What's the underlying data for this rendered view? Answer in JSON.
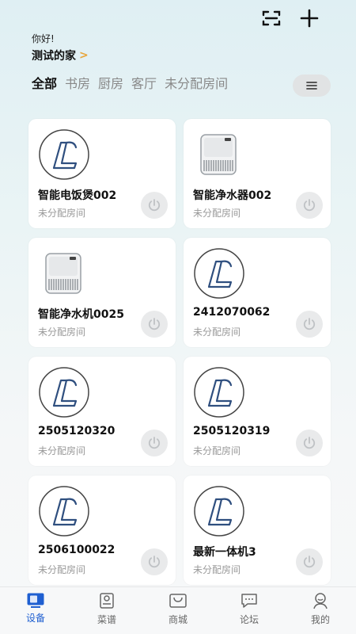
{
  "header": {
    "scan_icon": "scan-icon",
    "add_icon": "plus-icon",
    "greeting": "你好!",
    "home_name": "测试的家",
    "home_arrow": ">"
  },
  "tabs": [
    {
      "label": "全部",
      "active": true
    },
    {
      "label": "书房",
      "active": false
    },
    {
      "label": "厨房",
      "active": false
    },
    {
      "label": "客厅",
      "active": false
    },
    {
      "label": "未分配房间",
      "active": false
    }
  ],
  "menu_icon": "menu-icon",
  "devices": [
    {
      "name": "智能电饭煲002",
      "room": "未分配房间",
      "icon": "logo"
    },
    {
      "name": "智能净水器002",
      "room": "未分配房间",
      "icon": "purifier"
    },
    {
      "name": "智能净水机0025",
      "room": "未分配房间",
      "icon": "purifier"
    },
    {
      "name": "2412070062",
      "room": "未分配房间",
      "icon": "logo"
    },
    {
      "name": "2505120320",
      "room": "未分配房间",
      "icon": "logo"
    },
    {
      "name": "2505120319",
      "room": "未分配房间",
      "icon": "logo"
    },
    {
      "name": "2506100022",
      "room": "未分配房间",
      "icon": "logo"
    },
    {
      "name": "最新一体机3",
      "room": "未分配房间",
      "icon": "logo"
    }
  ],
  "nav": [
    {
      "label": "设备",
      "icon": "device-icon",
      "active": true
    },
    {
      "label": "菜谱",
      "icon": "recipe-icon",
      "active": false
    },
    {
      "label": "商城",
      "icon": "shop-icon",
      "active": false
    },
    {
      "label": "论坛",
      "icon": "forum-icon",
      "active": false
    },
    {
      "label": "我的",
      "icon": "profile-icon",
      "active": false
    }
  ],
  "colors": {
    "accent": "#1f5fd1",
    "arrow": "#e8a53b"
  }
}
